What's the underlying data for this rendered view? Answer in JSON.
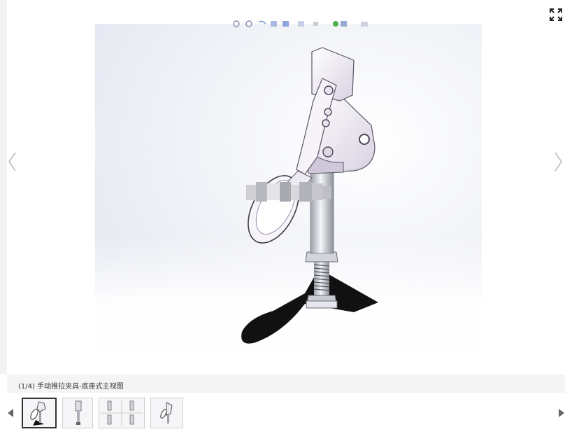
{
  "viewer": {
    "fullscreen_icon": "expand-icon",
    "prev_icon": "chevron-left-icon",
    "next_icon": "chevron-right-icon",
    "image_subject": "manual push-pull toggle clamp, base mount, front view",
    "cad_toolbar_icons": [
      "zoom-fit-icon",
      "zoom-icon",
      "rotate-icon",
      "view-icon",
      "section-icon",
      "display-icon",
      "hide-icon",
      "appearance-icon",
      "scene-icon"
    ]
  },
  "caption": {
    "text": "(1/4) 手动推拉夹具-底座式主视图"
  },
  "thumbnails": {
    "prev_icon": "triangle-left-icon",
    "next_icon": "triangle-right-icon",
    "items": [
      {
        "view": "main view",
        "active": true
      },
      {
        "view": "side view",
        "active": false
      },
      {
        "view": "drawing sheet",
        "active": false
      },
      {
        "view": "iso view",
        "active": false
      }
    ]
  },
  "colors": {
    "part_body": "#f2eef6",
    "part_shadow": "#9a90a8",
    "rod": "#dcdde3",
    "ground_shadow": "#111111",
    "caption_bg": "#f4f4f4"
  }
}
